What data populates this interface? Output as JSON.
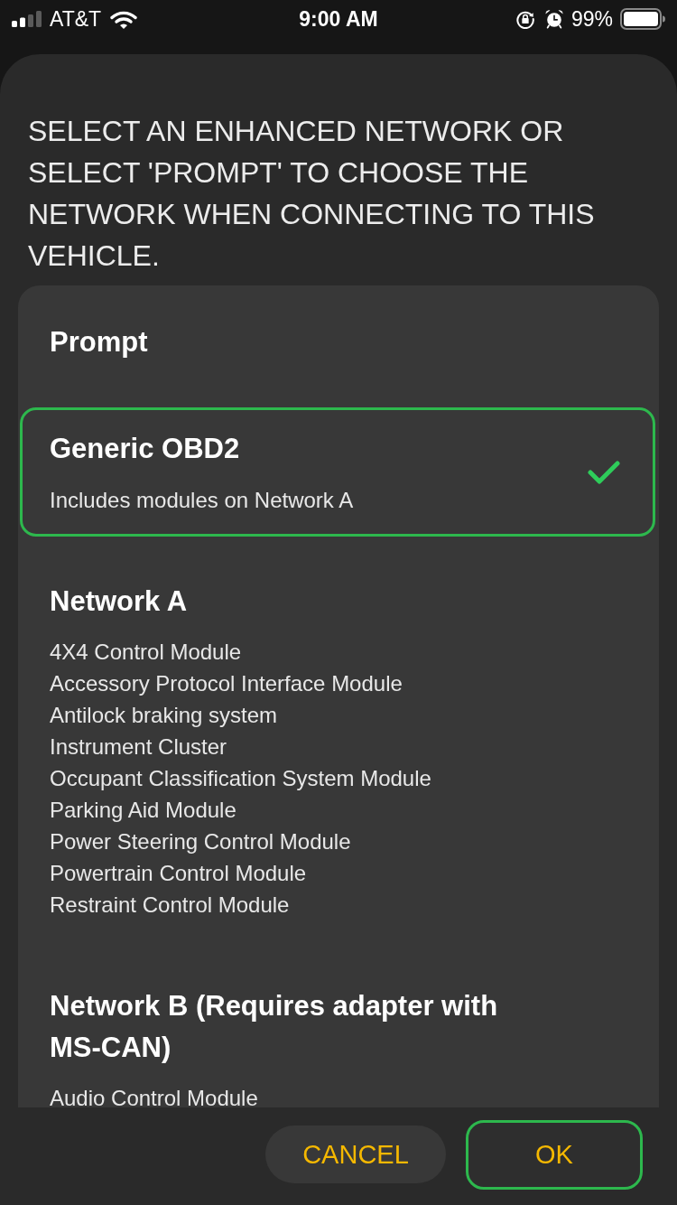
{
  "status_bar": {
    "carrier": "AT&T",
    "time": "9:00 AM",
    "battery": "99%"
  },
  "dialog": {
    "heading": "SELECT AN ENHANCED NETWORK OR SELECT 'PROMPT' TO CHOOSE THE NETWORK WHEN CONNECTING TO THIS VEHICLE.",
    "options": [
      {
        "title": "Prompt",
        "selected": false
      },
      {
        "title": "Generic OBD2",
        "subtitle": "Includes modules on Network A",
        "selected": true
      },
      {
        "title": "Network A",
        "modules": [
          "4X4 Control Module",
          "Accessory Protocol Interface Module",
          "Antilock braking system",
          "Instrument Cluster",
          "Occupant Classification System Module",
          "Parking Aid Module",
          "Power Steering Control Module",
          "Powertrain Control Module",
          "Restraint Control Module"
        ],
        "selected": false
      },
      {
        "title": "Network B (Requires adapter with MS-CAN)",
        "modules": [
          "Audio Control Module"
        ],
        "selected": false
      }
    ],
    "buttons": [
      {
        "label": "CANCEL",
        "focused": false
      },
      {
        "label": "OK",
        "focused": true
      }
    ]
  }
}
